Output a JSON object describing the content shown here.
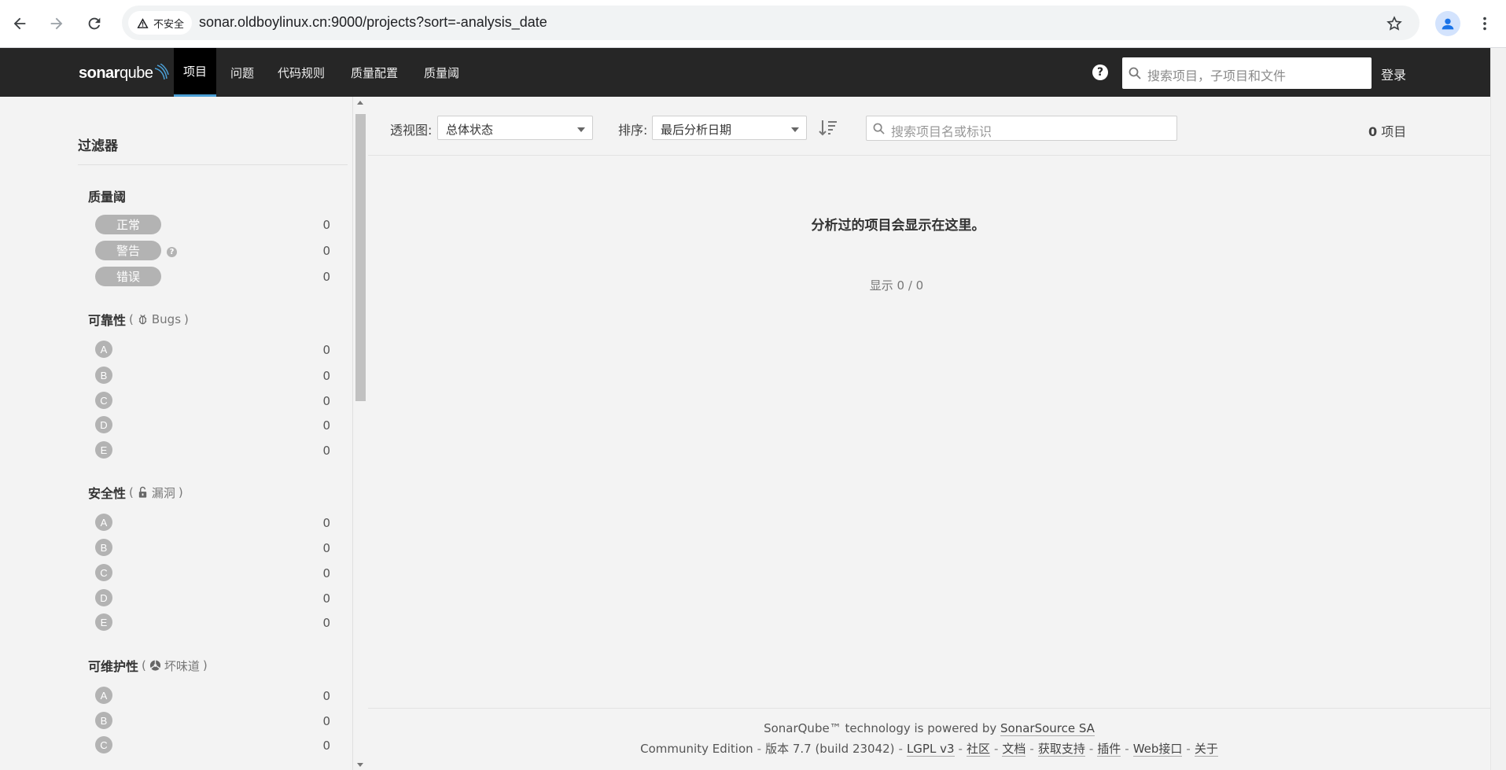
{
  "browser": {
    "security_label": "不安全",
    "url": "sonar.oldboylinux.cn:9000/projects?sort=-analysis_date"
  },
  "navbar": {
    "logo_text_bold": "sonar",
    "logo_text_light": "qube",
    "items": [
      {
        "label": "项目",
        "active": true
      },
      {
        "label": "问题"
      },
      {
        "label": "代码规则"
      },
      {
        "label": "质量配置"
      },
      {
        "label": "质量阈"
      }
    ],
    "help": "?",
    "search_placeholder": "搜索项目，子项目和文件",
    "login": "登录"
  },
  "sidebar": {
    "title": "过滤器",
    "quality_gate": {
      "title": "质量阈",
      "options": [
        {
          "label": "正常",
          "count": "0"
        },
        {
          "label": "警告",
          "count": "0"
        },
        {
          "label": "错误",
          "count": "0"
        }
      ]
    },
    "reliability": {
      "title": "可靠性",
      "paren_open": "(",
      "sub": "Bugs",
      "paren_close": ")",
      "ratings": [
        {
          "label": "A",
          "count": "0"
        },
        {
          "label": "B",
          "count": "0"
        },
        {
          "label": "C",
          "count": "0"
        },
        {
          "label": "D",
          "count": "0"
        },
        {
          "label": "E",
          "count": "0"
        }
      ]
    },
    "security": {
      "title": "安全性",
      "paren_open": "(",
      "sub": "漏洞",
      "paren_close": ")",
      "ratings": [
        {
          "label": "A",
          "count": "0"
        },
        {
          "label": "B",
          "count": "0"
        },
        {
          "label": "C",
          "count": "0"
        },
        {
          "label": "D",
          "count": "0"
        },
        {
          "label": "E",
          "count": "0"
        }
      ]
    },
    "maintainability": {
      "title": "可维护性",
      "paren_open": "(",
      "sub": "坏味道",
      "paren_close": ")",
      "ratings": [
        {
          "label": "A",
          "count": "0"
        },
        {
          "label": "B",
          "count": "0"
        },
        {
          "label": "C",
          "count": "0"
        }
      ]
    }
  },
  "toolbar": {
    "perspective_label": "透视图:",
    "perspective_value": "总体状态",
    "sort_label": "排序:",
    "sort_value": "最后分析日期",
    "search_placeholder": "搜索项目名或标识",
    "count_number": "0",
    "count_unit": "项目"
  },
  "main": {
    "empty_message": "分析过的项目会显示在这里。",
    "shown": "显示 0 / 0"
  },
  "footer": {
    "powered_prefix": "SonarQube™ technology is powered by",
    "powered_link": "SonarSource SA",
    "edition": "Community Edition",
    "version": "版本 7.7 (build 23042)",
    "links": [
      "LGPL v3",
      "社区",
      "文档",
      "获取支持",
      "插件",
      "Web接口",
      "关于"
    ]
  },
  "colors": {
    "navbar_bg": "#262626",
    "active_tab_border": "#4b9fd5",
    "pill_gray": "#b3b3b3"
  }
}
